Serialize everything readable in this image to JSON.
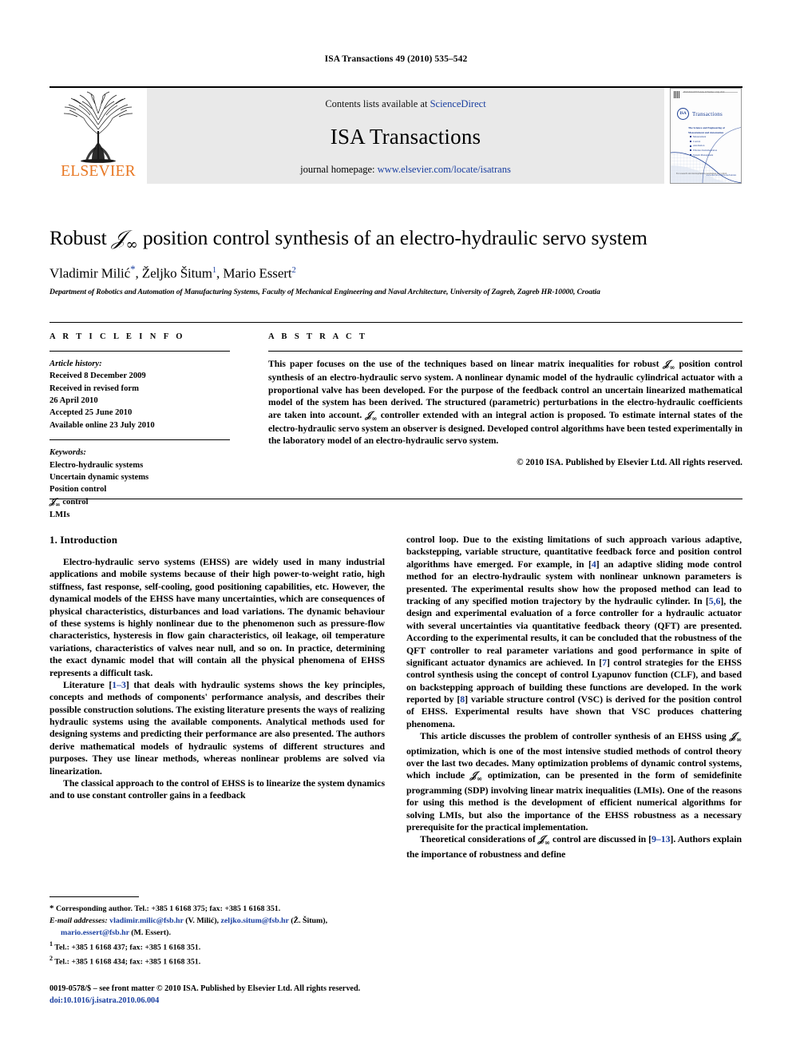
{
  "running_head": "ISA Transactions 49 (2010) 535–542",
  "masthead": {
    "contents_prefix": "Contents lists available at ",
    "contents_link": "ScienceDirect",
    "journal_title": "ISA Transactions",
    "homepage_prefix": "journal homepage: ",
    "homepage_url": "www.elsevier.com/locate/isatrans",
    "publisher": "ELSEVIER",
    "cover": {
      "logo_text": "ISA",
      "journal_name": "Transactions",
      "subtitle": "The Science and Engineering of Measurement and Automation",
      "topics": [
        "Measurement",
        "Control",
        "Automation",
        "Wireless Instrumentation",
        "System Management"
      ],
      "tagline": "For research and development in automation and control",
      "footer_left": "ISSN 0019-0578 Volume 49 Number 4 July 2010",
      "footer_right": "www.elsevier.com/locate/isatrans"
    }
  },
  "article": {
    "title_before": "Robust ",
    "title_math": "H∞",
    "title_after": " position control synthesis of an electro-hydraulic servo system",
    "authors": [
      {
        "name": "Vladimir Milić",
        "mark": "*"
      },
      {
        "name": "Željko Šitum",
        "mark": "1"
      },
      {
        "name": "Mario Essert",
        "mark": "2"
      }
    ],
    "affiliation": "Department of Robotics and Automation of Manufacturing Systems, Faculty of Mechanical Engineering and Naval Architecture, University of Zagreb, Zagreb HR-10000, Croatia"
  },
  "article_info": {
    "heading": "A R T I C L E   I N F O",
    "history_label": "Article history:",
    "history": [
      "Received 8 December 2009",
      "Received in revised form",
      "26 April 2010",
      "Accepted 25 June 2010",
      "Available online 23 July 2010"
    ],
    "keywords_label": "Keywords:",
    "keywords": [
      "Electro-hydraulic systems",
      "Uncertain dynamic systems",
      "Position control",
      "H∞ control",
      "LMIs"
    ]
  },
  "abstract": {
    "heading": "A B S T R A C T",
    "part1": "This paper focuses on the use of the techniques based on linear matrix inequalities for robust ",
    "part2": " position control synthesis of an electro-hydraulic servo system. A nonlinear dynamic model of the hydraulic cylindrical actuator with a proportional valve has been developed. For the purpose of the feedback control an uncertain linearized mathematical model of the system has been derived. The structured (parametric) perturbations in the electro-hydraulic coefficients are taken into account. ",
    "part3": " controller extended with an integral action is proposed. To estimate internal states of the electro-hydraulic servo system an observer is designed. Developed control algorithms have been tested experimentally in the laboratory model of an electro-hydraulic servo system.",
    "copyright": "© 2010 ISA. Published by Elsevier Ltd. All rights reserved."
  },
  "introduction": {
    "section_number_title": "1. Introduction",
    "left_paragraphs": [
      "Electro-hydraulic servo systems (EHSS) are widely used in many industrial applications and mobile systems because of their high power-to-weight ratio, high stiffness, fast response, self-cooling, good positioning capabilities, etc. However, the dynamical models of the EHSS have many uncertainties, which are consequences of physical characteristics, disturbances and load variations. The dynamic behaviour of these systems is highly nonlinear due to the phenomenon such as pressure-flow characteristics, hysteresis in flow gain characteristics, oil leakage, oil temperature variations, characteristics of valves near null, and so on. In practice, determining the exact dynamic model that will contain all the physical phenomena of EHSS represents a difficult task.",
      "Literature [1–3] that deals with hydraulic systems shows the key principles, concepts and methods of components' performance analysis, and describes their possible construction solutions. The existing literature presents the ways of realizing hydraulic systems using the available components. Analytical methods used for designing systems and predicting their performance are also presented. The authors derive mathematical models of hydraulic systems of different structures and purposes. They use linear methods, whereas nonlinear problems are solved via linearization.",
      "The classical approach to the control of EHSS is to linearize the system dynamics and to use constant controller gains in a feedback"
    ],
    "right_paragraph_1": "control loop. Due to the existing limitations of such approach various adaptive, backstepping, variable structure, quantitative feedback force and position control algorithms have emerged. For example, in [4] an adaptive sliding mode control method for an electro-hydraulic system with nonlinear unknown parameters is presented. The experimental results show how the proposed method can lead to tracking of any specified motion trajectory by the hydraulic cylinder. In [5,6], the design and experimental evaluation of a force controller for a hydraulic actuator with several uncertainties via quantitative feedback theory (QFT) are presented. According to the experimental results, it can be concluded that the robustness of the QFT controller to real parameter variations and good performance in spite of significant actuator dynamics are achieved. In [7] control strategies for the EHSS control synthesis using the concept of control Lyapunov function (CLF), and based on backstepping approach of building these functions are developed. In the work reported by [8] variable structure control (VSC) is derived for the position control of EHSS. Experimental results have shown that VSC produces chattering phenomena.",
    "right_paragraph_2a": "This article discusses the problem of controller synthesis of an EHSS using ",
    "right_paragraph_2b": " optimization, which is one of the most intensive studied methods of control theory over the last two decades. Many optimization problems of dynamic control systems, which include ",
    "right_paragraph_2c": " optimization, can be presented in the form of semidefinite programming (SDP) involving linear matrix inequalities (LMIs). One of the reasons for using this method is the development of efficient numerical algorithms for solving LMIs, but also the importance of the EHSS robustness as a necessary prerequisite for the practical implementation.",
    "right_paragraph_3a": "Theoretical considerations of ",
    "right_paragraph_3b": " control are discussed in [9–13]. Authors explain the importance of robustness and define"
  },
  "footnotes": {
    "corresponding": "Corresponding author. Tel.: +385 1 6168 375; fax: +385 1 6168 351.",
    "email_label": "E-mail addresses:",
    "emails": [
      {
        "address": "vladimir.milic@fsb.hr",
        "name": "(V. Milić)"
      },
      {
        "address": "zeljko.situm@fsb.hr",
        "name": "(Ž. Šitum)"
      },
      {
        "address": "mario.essert@fsb.hr",
        "name": "(M. Essert)"
      }
    ],
    "note1": "Tel.: +385 1 6168 437; fax: +385 1 6168 351.",
    "note2": "Tel.: +385 1 6168 434; fax: +385 1 6168 351.",
    "note1_mark": "1",
    "note2_mark": "2"
  },
  "imprint": {
    "line1": "0019-0578/$ – see front matter © 2010 ISA. Published by Elsevier Ltd. All rights reserved.",
    "doi": "doi:10.1016/j.isatra.2010.06.004"
  },
  "colors": {
    "link": "#1a3fa0",
    "elsevier_orange": "#E87722",
    "masthead_gray": "#e9e9e9"
  }
}
